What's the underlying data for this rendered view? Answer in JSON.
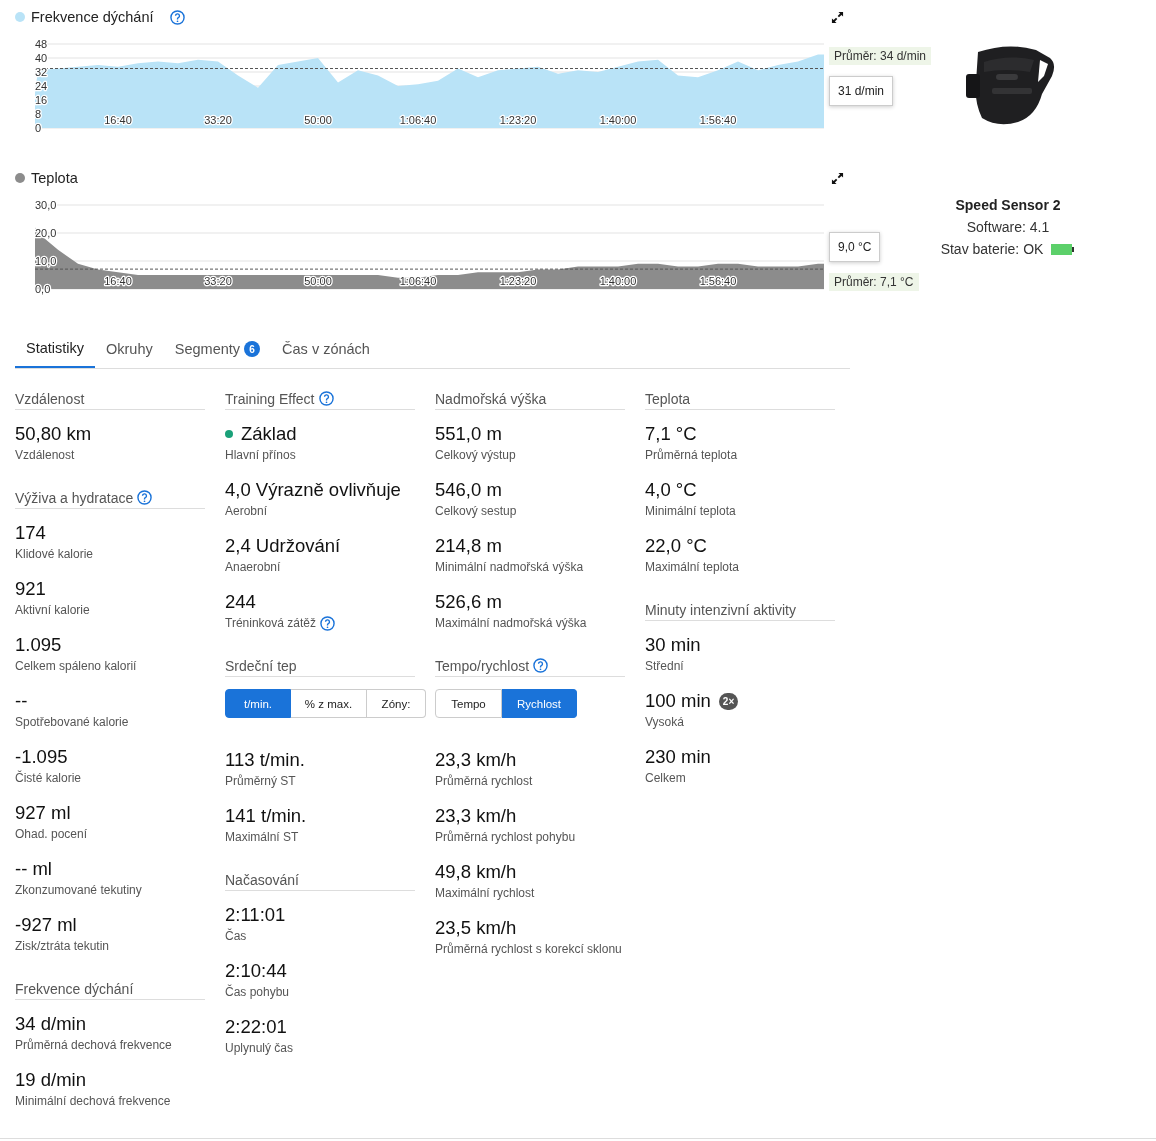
{
  "charts": [
    {
      "help": true,
      "chart_data": {
        "type": "area",
        "grid": true,
        "series": [
          {
            "name": "Frekvence dýchání",
            "color": "#b9e3f7",
            "values": [
              20,
              33,
              34,
              35,
              36,
              35,
              37,
              38,
              37,
              39,
              38,
              30,
              23,
              36,
              38,
              40,
              26,
              33,
              30,
              24,
              25,
              27,
              34,
              29,
              33,
              34,
              35,
              31,
              33,
              32,
              35,
              38,
              39,
              30,
              29,
              33,
              38,
              33,
              36,
              38,
              42,
              42
            ]
          }
        ],
        "x": [
          170,
          200,
          400,
          600,
          800,
          1000,
          1200,
          1400,
          1600,
          1800,
          2000,
          2200,
          2400,
          2600,
          2800,
          3000,
          3200,
          3400,
          3600,
          3800,
          4000,
          4200,
          4400,
          4600,
          4800,
          5000,
          5200,
          5400,
          5600,
          5800,
          6000,
          6200,
          6400,
          6600,
          6800,
          7000,
          7200,
          7400,
          7600,
          7800,
          8000,
          8060
        ],
        "xlim": [
          170,
          8060
        ],
        "ylim": [
          0,
          48
        ],
        "yticks": [
          0,
          8,
          16,
          24,
          32,
          40,
          48
        ],
        "xticks": [
          {
            "value": 1000,
            "label": "16:40"
          },
          {
            "value": 2000,
            "label": "33:20"
          },
          {
            "value": 3000,
            "label": "50:00"
          },
          {
            "value": 4000,
            "label": "1:06:40"
          },
          {
            "value": 5000,
            "label": "1:23:20"
          },
          {
            "value": 6000,
            "label": "1:40:00"
          },
          {
            "value": 7000,
            "label": "1:56:40"
          }
        ],
        "ref_lines": [
          {
            "axis": "y",
            "value": 34,
            "label": "Průměr: 34 d/min"
          }
        ],
        "annotations": [
          {
            "text": "31 d/min",
            "x": 8060,
            "y": 31
          }
        ]
      }
    },
    {
      "chart_data": {
        "type": "area",
        "grid": true,
        "series": [
          {
            "name": "Teplota",
            "color": "#8c8c8c",
            "values": [
              22,
              20,
              14,
              9,
              7,
              6,
              5,
              5,
              5,
              5,
              5,
              5,
              5,
              5,
              5,
              5,
              5,
              5,
              5,
              4,
              4,
              5,
              5,
              6,
              6,
              6,
              7,
              7,
              8,
              8,
              8,
              9,
              9,
              8,
              8,
              9,
              9,
              8,
              8,
              8,
              9,
              9
            ]
          }
        ],
        "x": [
          170,
          200,
          400,
          600,
          800,
          1000,
          1200,
          1400,
          1600,
          1800,
          2000,
          2200,
          2400,
          2600,
          2800,
          3000,
          3200,
          3400,
          3600,
          3800,
          4000,
          4200,
          4400,
          4600,
          4800,
          5000,
          5200,
          5400,
          5600,
          5800,
          6000,
          6200,
          6400,
          6600,
          6800,
          7000,
          7200,
          7400,
          7600,
          7800,
          8000,
          8060
        ],
        "xlim": [
          170,
          8060
        ],
        "ylim": [
          0,
          30
        ],
        "yticks": [
          {
            "value": 0,
            "label": "0,0"
          },
          {
            "value": 10,
            "label": "10,0"
          },
          {
            "value": 20,
            "label": "20,0"
          },
          {
            "value": 30,
            "label": "30,0"
          }
        ],
        "xticks": [
          {
            "value": 1000,
            "label": "16:40"
          },
          {
            "value": 2000,
            "label": "33:20"
          },
          {
            "value": 3000,
            "label": "50:00"
          },
          {
            "value": 4000,
            "label": "1:06:40"
          },
          {
            "value": 5000,
            "label": "1:23:20"
          },
          {
            "value": 6000,
            "label": "1:40:00"
          },
          {
            "value": 7000,
            "label": "1:56:40"
          }
        ],
        "ref_lines": [
          {
            "axis": "y",
            "value": 7.1,
            "label": "Průměr: 7,1 °C"
          }
        ],
        "annotations": [
          {
            "text": "9,0 °C",
            "x": 8060,
            "y": 9
          }
        ]
      }
    }
  ],
  "device": {
    "kind": "picture",
    "name": "Speed Sensor 2",
    "software": "Software: 4.1",
    "battery": "Stav baterie: OK"
  },
  "tabs": [
    {
      "label": "Statistiky",
      "selected": true
    },
    {
      "label": "Okruhy",
      "selected": false
    },
    {
      "label": "Segmenty",
      "selected": false,
      "badge": "6"
    },
    {
      "label": "Čas v zónách",
      "selected": false
    }
  ],
  "columns": [
    {
      "sections": [
        {
          "title": "Vzdálenost",
          "items": [
            {
              "value": "50,80 km",
              "label": "Vzdálenost"
            }
          ]
        },
        {
          "title": "Výživa a hydratace",
          "help": true,
          "items": [
            {
              "value": "174",
              "label": "Klidové kalorie"
            },
            {
              "value": "921",
              "label": "Aktivní kalorie"
            },
            {
              "value": "1.095",
              "label": "Celkem spáleno kalorií"
            },
            {
              "value": "--",
              "label": "Spotřebované kalorie"
            },
            {
              "value": "-1.095",
              "label": "Čisté kalorie"
            },
            {
              "value": "927 ml",
              "label": "Ohad. pocení"
            },
            {
              "value": "-- ml",
              "label": "Zkonzumované tekutiny"
            },
            {
              "value": "-927 ml",
              "label": "Zisk/ztráta tekutin"
            }
          ]
        },
        {
          "title": "Frekvence dýchání",
          "items": [
            {
              "value": "34 d/min",
              "label": "Průměrná dechová frekvence"
            },
            {
              "value": "19 d/min",
              "label": "Minimální dechová frekvence"
            }
          ]
        }
      ]
    },
    {
      "sections": [
        {
          "title": "Training Effect",
          "help": true,
          "items": [
            {
              "value": "Základ",
              "label": "Hlavní přínos",
              "color": "#1aa179"
            },
            {
              "value": "4,0 Výrazně ovlivňuje",
              "label": "Aerobní"
            },
            {
              "value": "2,4 Udržování",
              "label": "Anaerobní"
            },
            {
              "value": "244",
              "label": "Tréninková zátěž",
              "label_help": true
            }
          ]
        },
        {
          "title": "Srdeční tep",
          "toggle": [
            {
              "label": "t/min.",
              "selected": true
            },
            {
              "label": "% z max.",
              "selected": false
            },
            {
              "label": "Zóny:",
              "selected": false
            }
          ],
          "items": [
            {
              "value": "113 t/min.",
              "label": "Průměrný ST"
            },
            {
              "value": "141 t/min.",
              "label": "Maximální ST"
            }
          ]
        },
        {
          "title": "Načasování",
          "items": [
            {
              "value": "2:11:01",
              "label": "Čas"
            },
            {
              "value": "2:10:44",
              "label": "Čas pohybu"
            },
            {
              "value": "2:22:01",
              "label": "Uplynulý čas"
            }
          ]
        }
      ]
    },
    {
      "sections": [
        {
          "title": "Nadmořská výška",
          "items": [
            {
              "value": "551,0 m",
              "label": "Celkový výstup"
            },
            {
              "value": "546,0 m",
              "label": "Celkový sestup"
            },
            {
              "value": "214,8 m",
              "label": "Minimální nadmořská výška"
            },
            {
              "value": "526,6 m",
              "label": "Maximální nadmořská výška"
            }
          ]
        },
        {
          "title": "Tempo/rychlost",
          "help": true,
          "toggle": [
            {
              "label": "Tempo",
              "selected": false
            },
            {
              "label": "Rychlost",
              "selected": true
            }
          ],
          "items": [
            {
              "value": "23,3 km/h",
              "label": "Průměrná rychlost"
            },
            {
              "value": "23,3 km/h",
              "label": "Průměrná rychlost pohybu"
            },
            {
              "value": "49,8 km/h",
              "label": "Maximální rychlost"
            },
            {
              "value": "23,5 km/h",
              "label": "Průměrná rychlost s korekcí sklonu"
            }
          ]
        }
      ]
    },
    {
      "sections": [
        {
          "title": "Teplota",
          "items": [
            {
              "value": "7,1 °C",
              "label": "Průměrná teplota"
            },
            {
              "value": "4,0 °C",
              "label": "Minimální teplota"
            },
            {
              "value": "22,0 °C",
              "label": "Maximální teplota"
            }
          ]
        },
        {
          "title": "Minuty intenzivní aktivity",
          "items": [
            {
              "value": "30 min",
              "label": "Střední"
            },
            {
              "value": "100 min",
              "label": "Vysoká",
              "badge": "2×"
            },
            {
              "value": "230 min",
              "label": "Celkem"
            }
          ]
        }
      ]
    }
  ]
}
